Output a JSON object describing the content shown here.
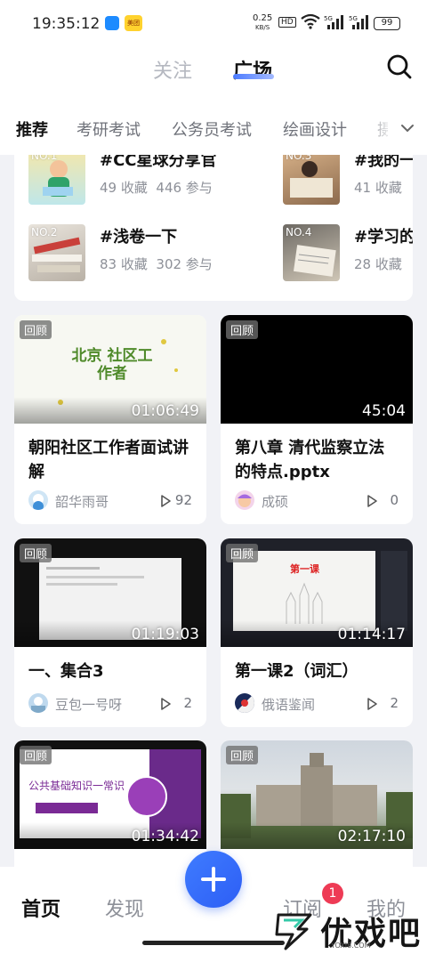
{
  "status_bar": {
    "time": "19:35:12",
    "app_badge_text": "美团",
    "net_speed": "0.25",
    "net_unit": "KB/S",
    "hd": "HD",
    "signal_label": "5G",
    "battery": "99"
  },
  "header": {
    "tab_follow": "关注",
    "tab_square": "广场"
  },
  "categories": [
    "推荐",
    "考研考试",
    "公务员考试",
    "绘画设计",
    "摄"
  ],
  "ranking": [
    {
      "no": "NO.1",
      "title": "#CC星球分享官",
      "favorites": "49 收藏",
      "joins": "446 参与"
    },
    {
      "no": "NO.3",
      "title": "#我的一",
      "favorites": "41 收藏",
      "joins": ""
    },
    {
      "no": "NO.2",
      "title": "#浅卷一下",
      "favorites": "83 收藏",
      "joins": "302 参与"
    },
    {
      "no": "NO.4",
      "title": "#学习的",
      "favorites": "28 收藏",
      "joins": ""
    }
  ],
  "cards": [
    {
      "badge": "回顾",
      "duration": "01:06:49",
      "title": "朝阳社区工作者面试讲解",
      "author": "韶华雨哥",
      "plays": "92",
      "thumb_text": "北京 社区工作者"
    },
    {
      "badge": "回顾",
      "duration": "45:04",
      "title": "第八章 清代监察立法的特点.pptx",
      "author": "成硕",
      "plays": "0"
    },
    {
      "badge": "回顾",
      "duration": "01:19:03",
      "title": "一、集合3",
      "author": "豆包一号呀",
      "plays": "2"
    },
    {
      "badge": "回顾",
      "duration": "01:14:17",
      "title": "第一课2（词汇）",
      "author": "俄语鉴闻",
      "plays": "2",
      "thumb_text": "第一课"
    },
    {
      "badge": "回顾",
      "duration": "01:34:42",
      "title": "",
      "author": "",
      "plays": "",
      "thumb_text": "公共基础知识一常识"
    },
    {
      "badge": "回顾",
      "duration": "02:17:10",
      "title": "",
      "author": "",
      "plays": ""
    }
  ],
  "bottom_nav": {
    "home": "首页",
    "discover": "发现",
    "subscribe": "订阅",
    "subscribe_badge": "1",
    "mine": "我的"
  },
  "watermark": {
    "text": "优戏吧",
    "sub": "YOXI8.COM"
  }
}
